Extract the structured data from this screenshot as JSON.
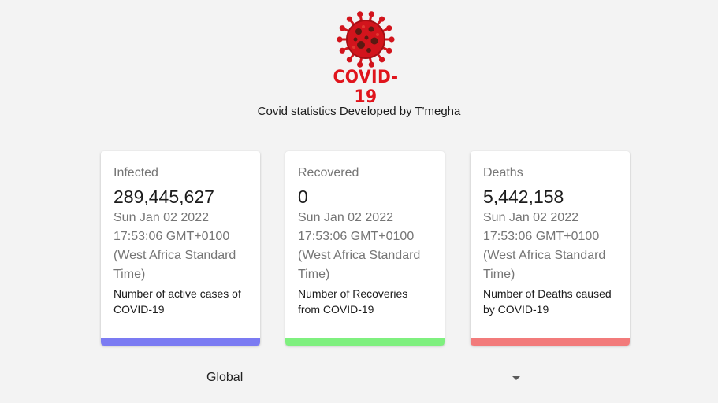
{
  "logo": {
    "text": "COVID-19",
    "color": "#e0141c"
  },
  "subtitle": "Covid statistics Developed by T'megha",
  "cards": [
    {
      "label": "Infected",
      "count": "289,445,627",
      "date": "Sun Jan 02 2022 17:53:06 GMT+0100 (West Africa Standard Time)",
      "description": "Number of active cases of COVID-19",
      "accent": "#7b7bf2"
    },
    {
      "label": "Recovered",
      "count": "0",
      "date": "Sun Jan 02 2022 17:53:06 GMT+0100 (West Africa Standard Time)",
      "description": "Number of Recoveries from COVID-19",
      "accent": "#7ff07f"
    },
    {
      "label": "Deaths",
      "count": "5,442,158",
      "date": "Sun Jan 02 2022 17:53:06 GMT+0100 (West Africa Standard Time)",
      "description": "Number of Deaths caused by COVID-19",
      "accent": "#f27b7b"
    }
  ],
  "country_select": {
    "selected": "Global",
    "icon": "chevron-down-icon"
  }
}
